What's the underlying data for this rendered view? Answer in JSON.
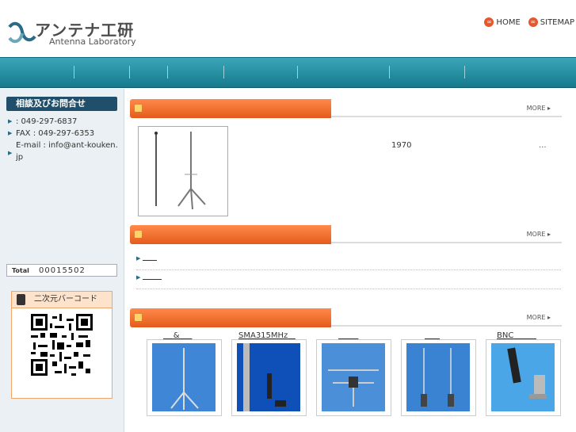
{
  "header": {
    "logo_title": "アンテナ工研",
    "logo_subtitle": "Antenna Laboratory",
    "links": [
      {
        "label": "HOME",
        "icon": "home-circle-icon"
      },
      {
        "label": "SITEMAP",
        "icon": "sitemap-circle-icon"
      }
    ]
  },
  "sidebar": {
    "contact_heading": "相談及びお問合せ",
    "contact_lines": [
      ": 049-297-6837",
      "FAX : 049-297-6353",
      "E-mail : info@ant-kouken.jp"
    ],
    "total_label": "Total",
    "total_count": "00015502",
    "qr_heading": "二次元バーコード"
  },
  "sections": {
    "more_label": "MORE ▸",
    "about_year": "1970",
    "about_ellipsis": "..."
  },
  "products": [
    {
      "caption": "&"
    },
    {
      "caption": "SMA315MHz"
    },
    {
      "caption": ""
    },
    {
      "caption": ""
    },
    {
      "caption": "BNC"
    }
  ],
  "colors": {
    "nav": "#167a8e",
    "section_bar": "#e45b1c",
    "sidebar_head": "#1f4f6b"
  }
}
